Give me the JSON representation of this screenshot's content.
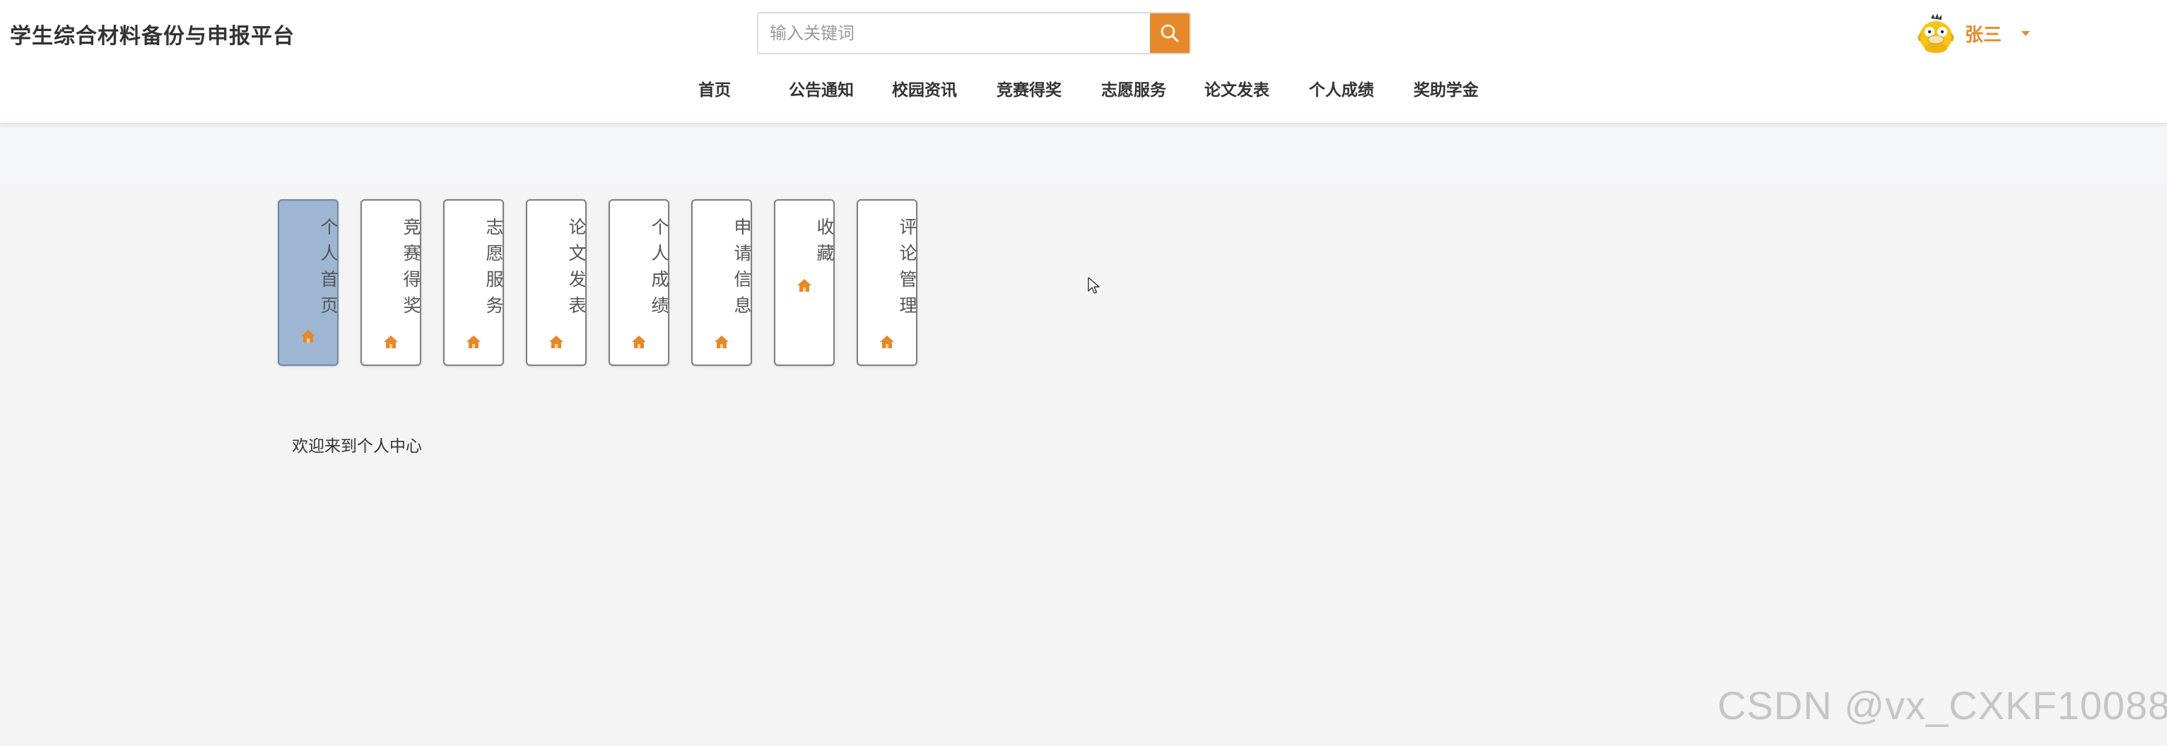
{
  "header": {
    "site_title": "学生综合材料备份与申报平台",
    "search": {
      "placeholder": "输入关键词",
      "value": ""
    },
    "search_icon": "search-icon",
    "user": {
      "name": "张三",
      "avatar_icon": "cartoon-duck-avatar"
    },
    "accent_color": "#e6892b"
  },
  "nav": {
    "items": [
      {
        "label": "首页"
      },
      {
        "label": "公告通知"
      },
      {
        "label": "校园资讯"
      },
      {
        "label": "竞赛得奖"
      },
      {
        "label": "志愿服务"
      },
      {
        "label": "论文发表"
      },
      {
        "label": "个人成绩"
      },
      {
        "label": "奖助学金"
      }
    ]
  },
  "side_tabs": {
    "items": [
      {
        "label": "个人首页",
        "active": true,
        "icon": "home-icon"
      },
      {
        "label": "竞赛得奖",
        "active": false,
        "icon": "home-icon"
      },
      {
        "label": "志愿服务",
        "active": false,
        "icon": "home-icon"
      },
      {
        "label": "论文发表",
        "active": false,
        "icon": "home-icon"
      },
      {
        "label": "个人成绩",
        "active": false,
        "icon": "home-icon"
      },
      {
        "label": "申请信息",
        "active": false,
        "icon": "home-icon"
      },
      {
        "label": "收藏",
        "active": false,
        "icon": "home-icon"
      },
      {
        "label": "评论管理",
        "active": false,
        "icon": "home-icon"
      }
    ],
    "active_color": "#9fb6d3"
  },
  "content": {
    "welcome_text": "欢迎来到个人中心"
  },
  "watermark": "CSDN @vx_CXKF10088"
}
